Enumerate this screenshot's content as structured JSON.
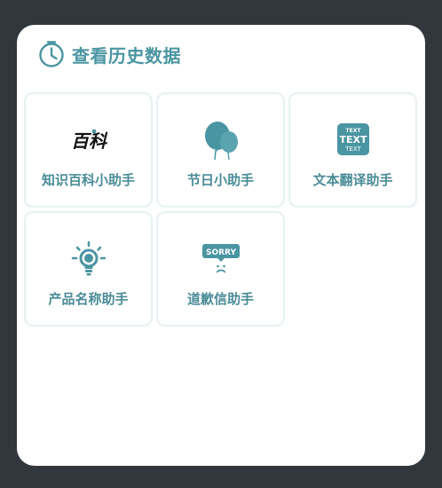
{
  "header": {
    "title": "查看历史数据",
    "icon": "clock-icon"
  },
  "colors": {
    "accent": "#4a95a2",
    "label": "#4a8c97",
    "tile_border": "#e7f0f2",
    "background": "#32363d",
    "card": "#ffffff"
  },
  "tools": [
    {
      "label": "知识百科小助手",
      "icon": "baike-logo-icon",
      "logo_text": "百科"
    },
    {
      "label": "节日小助手",
      "icon": "balloons-icon"
    },
    {
      "label": "文本翻译助手",
      "icon": "text-translate-icon",
      "icon_lines": [
        "TEXT",
        "TEXT",
        "TEXT"
      ]
    },
    {
      "label": "产品名称助手",
      "icon": "lightbulb-icon"
    },
    {
      "label": "道歉信助手",
      "icon": "sorry-sign-icon",
      "icon_text": "SORRY"
    }
  ]
}
